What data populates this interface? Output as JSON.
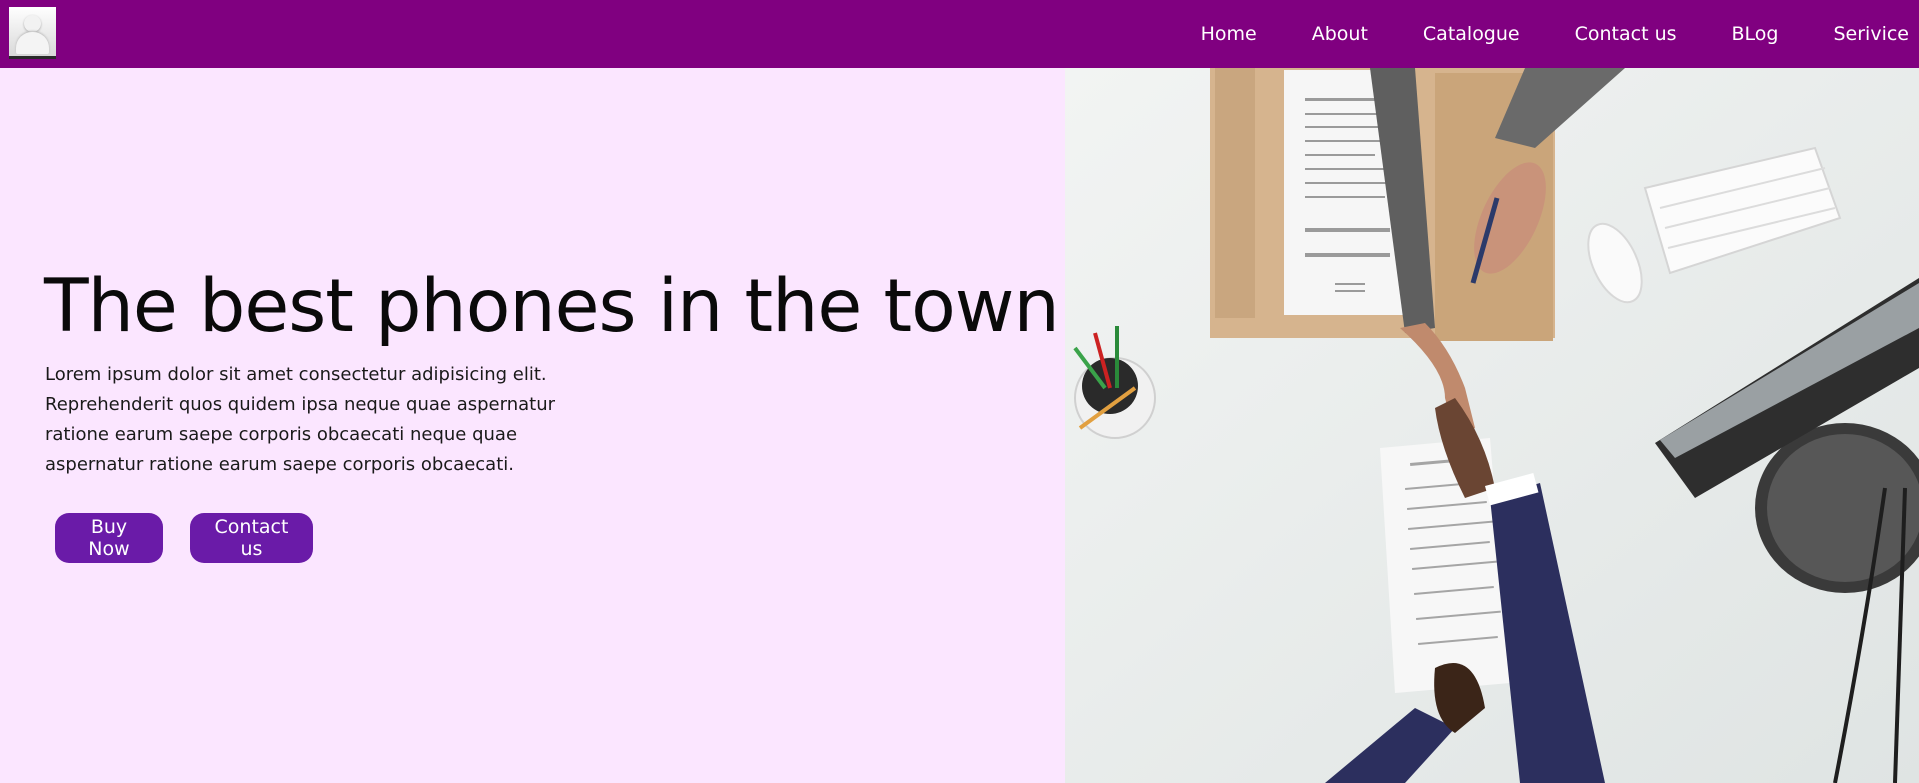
{
  "nav": {
    "logo_alt": "site logo",
    "links": [
      "Home",
      "About",
      "Catalogue",
      "Contact us",
      "BLog",
      "Serivice"
    ]
  },
  "hero": {
    "title": "The best phones in the town",
    "text": "Lorem ipsum dolor sit amet consectetur adipisicing elit. Reprehenderit quos quidem ipsa neque quae aspernatur ratione earum saepe corporis obcaecati neque quae aspernatur ratione earum saepe corporis obcaecati.",
    "buy_label": "Buy Now",
    "contact_label": "Contact us"
  },
  "colors": {
    "navbar": "#800080",
    "hero_background": "#fbe6ff",
    "button": "#6a1ba8"
  },
  "image": {
    "description_icon": "handshake-photo"
  }
}
